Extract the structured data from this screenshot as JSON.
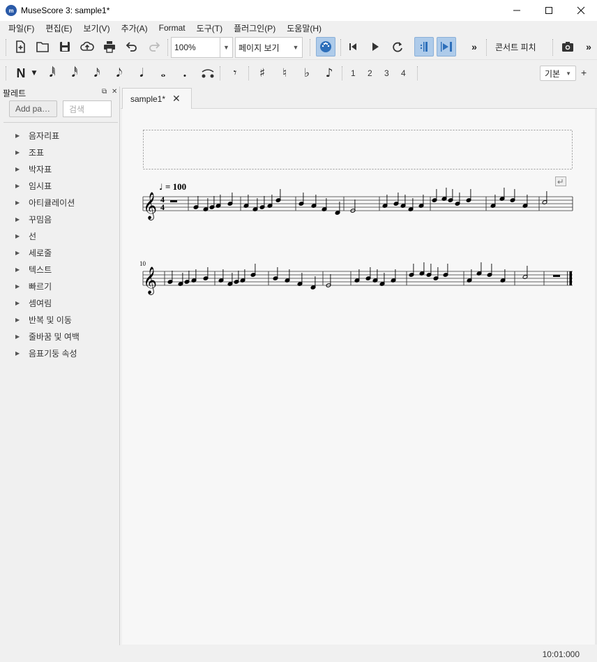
{
  "window": {
    "title": "MuseScore 3: sample1*",
    "app_icon_text": "m"
  },
  "menu": [
    "파일(F)",
    "편집(E)",
    "보기(V)",
    "추가(A)",
    "Format",
    "도구(T)",
    "플러그인(P)",
    "도움말(H)"
  ],
  "toolbar": {
    "zoom": "100%",
    "view_mode": "페이지 보기",
    "more": "»",
    "concert_pitch": "콘서트 피치",
    "more2": "»"
  },
  "note_input": {
    "n_label": "N",
    "voices": [
      "1",
      "2",
      "3",
      "4"
    ],
    "workspace": "기본",
    "add_workspace": "+"
  },
  "palette": {
    "title": "팔레트",
    "add_palettes": "Add pa…",
    "search_placeholder": "검색",
    "items": [
      "음자리표",
      "조표",
      "박자표",
      "임시표",
      "아티큘레이션",
      "꾸밈음",
      "선",
      "세로줄",
      "텍스트",
      "빠르기",
      "셈여림",
      "반복 및 이동",
      "줄바꿈 및 여백",
      "음표기둥 속성"
    ]
  },
  "document_tab": {
    "label": "sample1*",
    "close": "✕"
  },
  "score": {
    "tempo_note": "♩",
    "tempo_value": "= 100",
    "time_signature": [
      "4",
      "4"
    ],
    "measure_number": "10"
  },
  "status": {
    "time": "10:01:000"
  },
  "colors": {
    "accent": "#2a5aa8",
    "active_button": "#aecbea",
    "page": "#f7f7f7"
  }
}
